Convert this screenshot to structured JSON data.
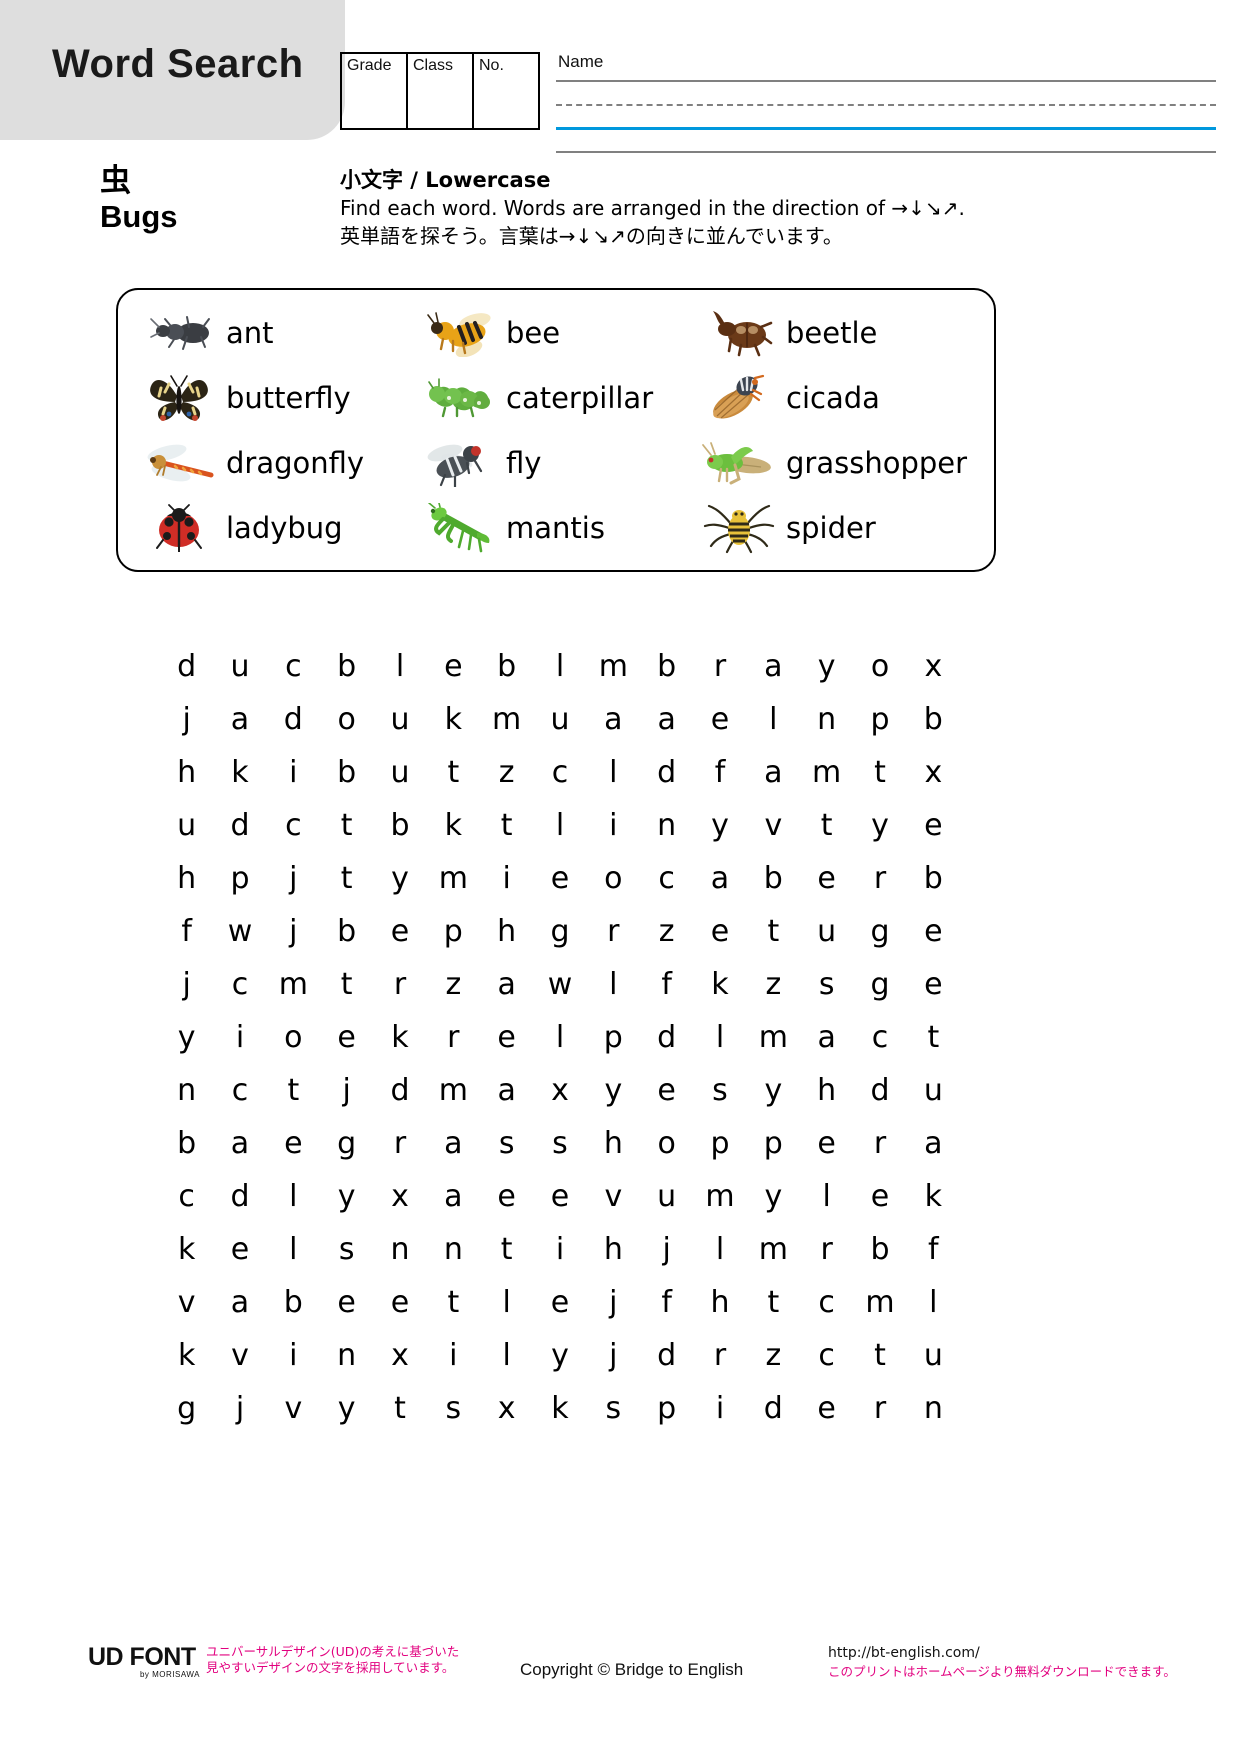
{
  "header": {
    "title": "Word Search",
    "info_cells": [
      "Grade",
      "Class",
      "No."
    ],
    "name_label": "Name"
  },
  "subject": {
    "jp": "虫",
    "en": "Bugs"
  },
  "instructions": {
    "heading": "小文字 / Lowercase",
    "english": "Find each word.  Words are arranged in the direction of →↓↘↗.",
    "japanese": "英単語を探そう。言葉は→↓↘↗の向きに並んでいます。"
  },
  "word_list": [
    {
      "word": "ant",
      "icon": "ant-icon"
    },
    {
      "word": "bee",
      "icon": "bee-icon"
    },
    {
      "word": "beetle",
      "icon": "beetle-icon"
    },
    {
      "word": "butterfly",
      "icon": "butterfly-icon"
    },
    {
      "word": "caterpillar",
      "icon": "caterpillar-icon"
    },
    {
      "word": "cicada",
      "icon": "cicada-icon"
    },
    {
      "word": "dragonfly",
      "icon": "dragonfly-icon"
    },
    {
      "word": "fly",
      "icon": "fly-icon"
    },
    {
      "word": "grasshopper",
      "icon": "grasshopper-icon"
    },
    {
      "word": "ladybug",
      "icon": "ladybug-icon"
    },
    {
      "word": "mantis",
      "icon": "mantis-icon"
    },
    {
      "word": "spider",
      "icon": "spider-icon"
    }
  ],
  "grid": {
    "columns": 15,
    "rows": 15,
    "letters": [
      [
        "d",
        "u",
        "c",
        "b",
        "l",
        "e",
        "b",
        "l",
        "m",
        "b",
        "r",
        "a",
        "y",
        "o",
        "x"
      ],
      [
        "j",
        "a",
        "d",
        "o",
        "u",
        "k",
        "m",
        "u",
        "a",
        "a",
        "e",
        "l",
        "n",
        "p",
        "b"
      ],
      [
        "h",
        "k",
        "i",
        "b",
        "u",
        "t",
        "z",
        "c",
        "l",
        "d",
        "f",
        "a",
        "m",
        "t",
        "x"
      ],
      [
        "u",
        "d",
        "c",
        "t",
        "b",
        "k",
        "t",
        "l",
        "i",
        "n",
        "y",
        "v",
        "t",
        "y",
        "e"
      ],
      [
        "h",
        "p",
        "j",
        "t",
        "y",
        "m",
        "i",
        "e",
        "o",
        "c",
        "a",
        "b",
        "e",
        "r",
        "b"
      ],
      [
        "f",
        "w",
        "j",
        "b",
        "e",
        "p",
        "h",
        "g",
        "r",
        "z",
        "e",
        "t",
        "u",
        "g",
        "e"
      ],
      [
        "j",
        "c",
        "m",
        "t",
        "r",
        "z",
        "a",
        "w",
        "l",
        "f",
        "k",
        "z",
        "s",
        "g",
        "e"
      ],
      [
        "y",
        "i",
        "o",
        "e",
        "k",
        "r",
        "e",
        "l",
        "p",
        "d",
        "l",
        "m",
        "a",
        "c",
        "t"
      ],
      [
        "n",
        "c",
        "t",
        "j",
        "d",
        "m",
        "a",
        "x",
        "y",
        "e",
        "s",
        "y",
        "h",
        "d",
        "u"
      ],
      [
        "b",
        "a",
        "e",
        "g",
        "r",
        "a",
        "s",
        "s",
        "h",
        "o",
        "p",
        "p",
        "e",
        "r",
        "a"
      ],
      [
        "c",
        "d",
        "l",
        "y",
        "x",
        "a",
        "e",
        "e",
        "v",
        "u",
        "m",
        "y",
        "l",
        "e",
        "k"
      ],
      [
        "k",
        "e",
        "l",
        "s",
        "n",
        "n",
        "t",
        "i",
        "h",
        "j",
        "l",
        "m",
        "r",
        "b",
        "f"
      ],
      [
        "v",
        "a",
        "b",
        "e",
        "e",
        "t",
        "l",
        "e",
        "j",
        "f",
        "h",
        "t",
        "c",
        "m",
        "l"
      ],
      [
        "k",
        "v",
        "i",
        "n",
        "x",
        "i",
        "l",
        "y",
        "j",
        "d",
        "r",
        "z",
        "c",
        "t",
        "u"
      ],
      [
        "g",
        "j",
        "v",
        "y",
        "t",
        "s",
        "x",
        "k",
        "s",
        "p",
        "i",
        "d",
        "e",
        "r",
        "n"
      ]
    ]
  },
  "footer": {
    "logo_main": "UD FONT",
    "logo_sub": "by MORISAWA",
    "ud_text_line1": "ユニバーサルデザイン(UD)の考えに基づいた",
    "ud_text_line2": "見やすいデザインの文字を採用しています。",
    "copyright": "Copyright © Bridge to English",
    "url": "http://bt-english.com/",
    "note": "このプリントはホームページより無料ダウンロードできます。"
  },
  "colors": {
    "plate": "#dedede",
    "blue_rule": "#0098dd",
    "magenta_text": "#e2007f"
  }
}
